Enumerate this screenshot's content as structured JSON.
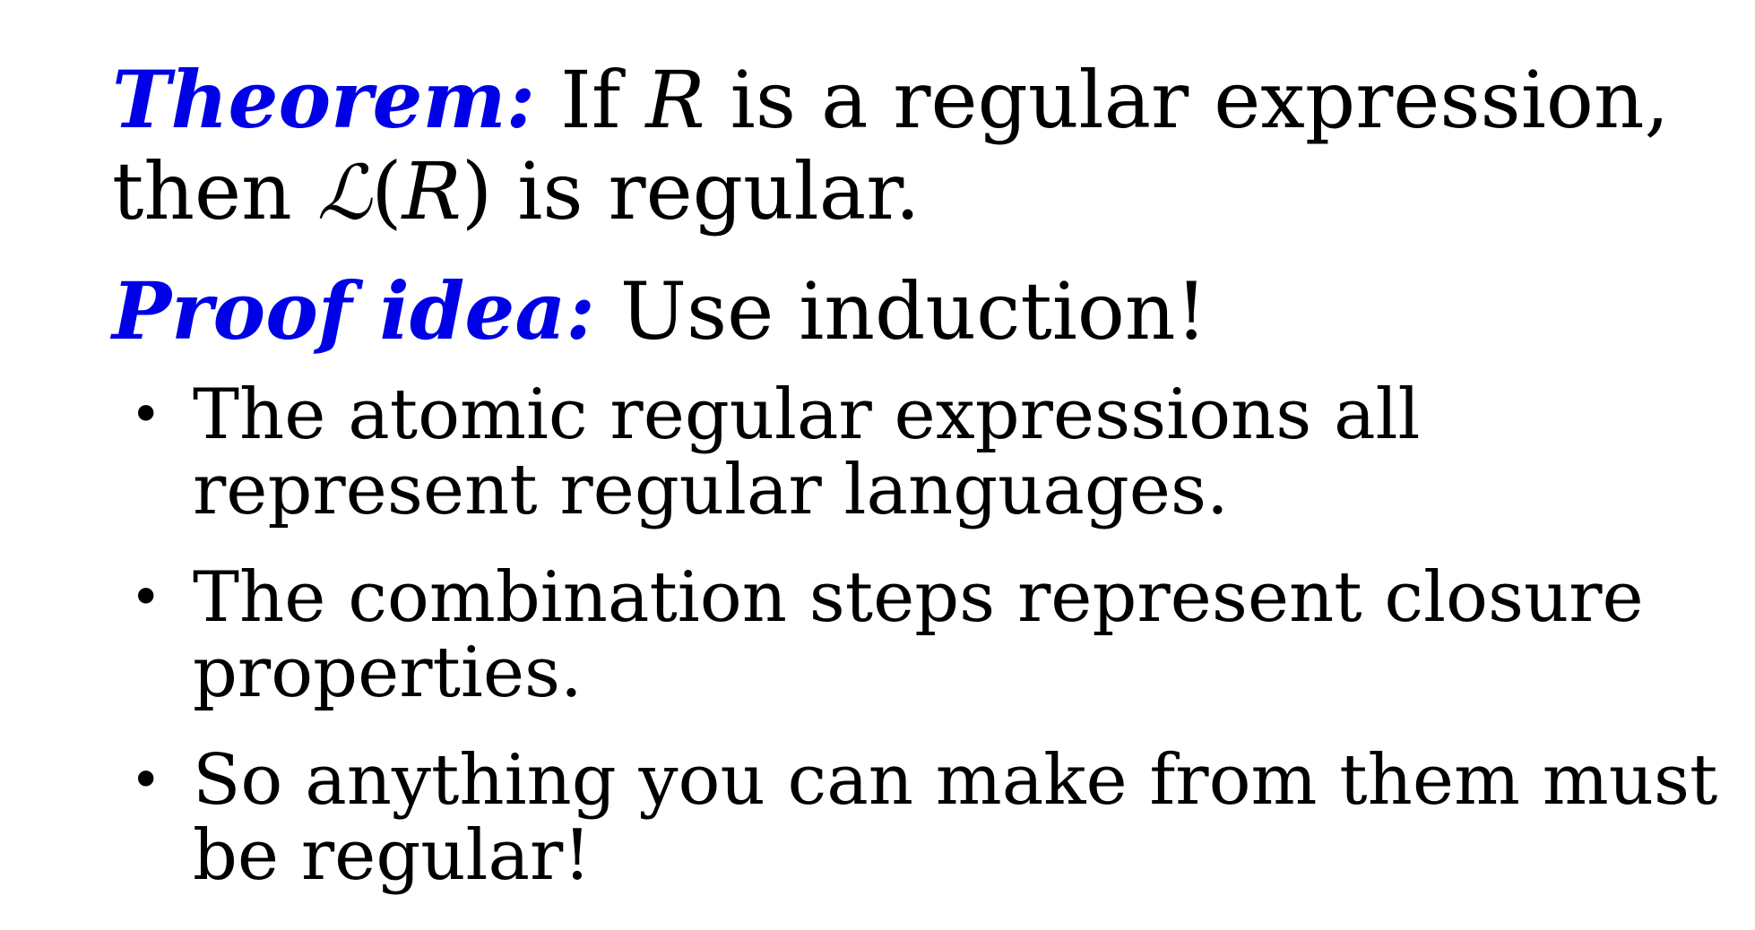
{
  "theorem": {
    "label": "Theorem:",
    "text_before_R": "If",
    "var_R": "R",
    "text_after_R": "is a regular expression,",
    "line2_then": "then",
    "script_L": "ℒ",
    "open_paren": "(",
    "var_R2": "R",
    "close_paren": ")",
    "line2_rest": "is regular."
  },
  "proof": {
    "label": "Proof idea:",
    "text": "Use induction!"
  },
  "bullets": [
    "The atomic regular expressions all represent regular languages.",
    "The combination steps represent closure properties.",
    "So anything you can make from them must be regular!"
  ],
  "bullet_symbol": "•",
  "colors": {
    "label": "#0000e6",
    "text": "#000000",
    "background": "#ffffff"
  }
}
